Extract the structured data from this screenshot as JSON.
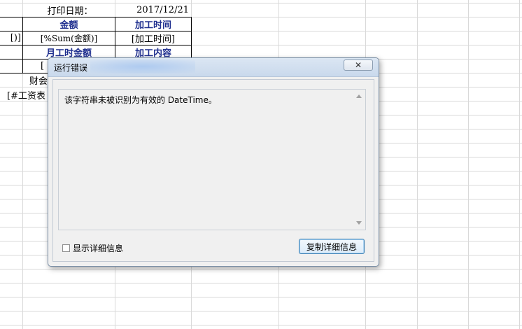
{
  "sheet": {
    "print_date_label": "打印日期：",
    "print_date_value": "2017/12/21",
    "header_amount": "金额",
    "header_time": "加工时间",
    "row1_left": "[)]",
    "row1_amount": "[%Sum(金额)]",
    "row1_time": "[加工时间]",
    "header_month_amount": "月工时金额",
    "header_content": "加工内容",
    "row3_left": "[",
    "finance_label": "财会",
    "salary_ref": "[#工资表"
  },
  "dialog": {
    "title": "运行错误",
    "close_symbol": "✕",
    "message": "该字符串未被识别为有效的 DateTime。",
    "show_details_label": "显示详细信息",
    "copy_details_label": "复制详细信息"
  }
}
